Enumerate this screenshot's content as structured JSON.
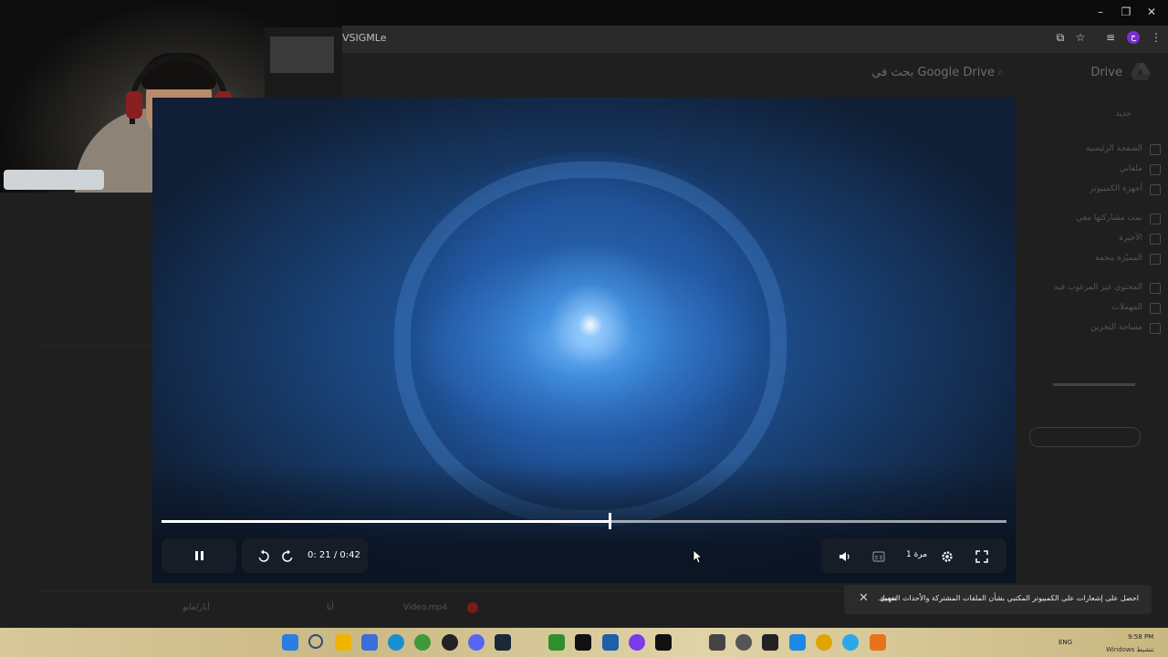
{
  "browser": {
    "url_text": "VSIGMLe",
    "window_controls": [
      "minimize-icon",
      "restore-icon",
      "close-icon"
    ],
    "profile_initial": "ح"
  },
  "drive": {
    "title": "بحث في Google Drive",
    "logo_text": "Drive",
    "sidebar": [
      "جديد",
      "الصفحة الرئيسية",
      "ملفاتي",
      "أجهزة الكمبيوتر",
      "تمت مشاركتها معي",
      "الأخيرة",
      "المميّزة بنجمة",
      "المحتوى غير المرغوب فيه",
      "المهملات",
      "مساحة التخزين"
    ],
    "bottom_row": [
      "أيار/مايو",
      "أنا",
      "Video.mp4"
    ]
  },
  "player": {
    "time_display": "0: 21 / 0:42",
    "progress": 0.53,
    "speed_label": "1 مرة",
    "controls": [
      "pause-icon",
      "rewind-10-icon",
      "forward-10-icon",
      "volume-icon",
      "captions-icon",
      "settings-icon",
      "fullscreen-icon"
    ]
  },
  "toast": {
    "message": "احصل على إشعارات على الكمبيوتر المكتبي بشأن الملفات المشتركة والأحداث المهمة.",
    "action": "تفعيل"
  },
  "taskbar": {
    "tray_lang": "ENG",
    "clock_time": "9:58 PM",
    "watermark": "Windows تنشيط"
  },
  "colors": {
    "player_accent": "#ffffff",
    "toast_bg": "#2b2b2b",
    "profile": "#7b2fd0"
  }
}
